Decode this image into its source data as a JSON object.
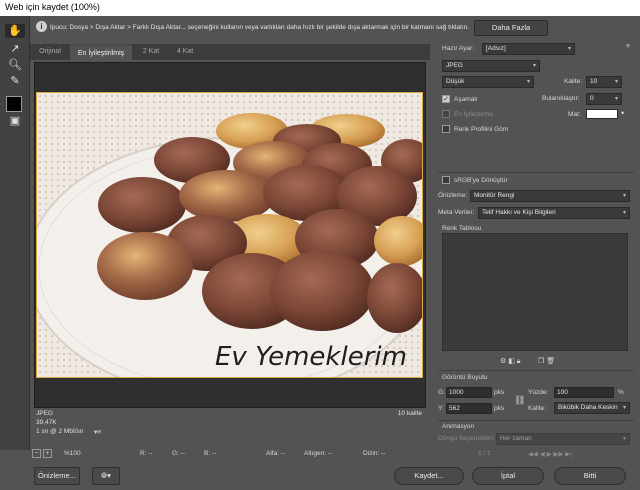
{
  "window": {
    "title": "Web için kaydet (100%)"
  },
  "tip": {
    "icon": "info-icon",
    "text": "İpucu: Dosya > Dışa Aktar > Farklı Dışa Aktar... seçeneğini kullanın veya varlıkları daha hızlı bir şekilde dışa aktarmak için bir katmanı sağ tıklatın.",
    "button": "Daha Fazla"
  },
  "tools": [
    "hand-icon",
    "slice-select-icon",
    "zoom-icon",
    "eyedropper-icon",
    "eyedropper-color-swatch",
    "toggle-slices-icon"
  ],
  "tabs": [
    {
      "label": "Orijinal"
    },
    {
      "label": "En İyileştirilmiş"
    },
    {
      "label": "2 Kat"
    },
    {
      "label": "4 Kat"
    }
  ],
  "preview": {
    "watermark": "Ev Yemeklerim",
    "format": "JPEG",
    "size": "39,47K",
    "time": "1 sn @ 2 Mbİ/sn",
    "quality": "10 kalite"
  },
  "status": {
    "zoom": "%100",
    "r": "R: --",
    "g": "G: --",
    "b": "B: --",
    "alpha": "Alfa: --",
    "hex": "Altıgen: --",
    "index": "Dizin: --"
  },
  "bottom": {
    "preview": "Önizleme...",
    "save": "Kaydet...",
    "cancel": "İptal",
    "done": "Bitti"
  },
  "settings": {
    "preset_label": "Hazır Ayar:",
    "preset_value": "[Adsız]",
    "format": "JPEG",
    "quality_level": "Düşük",
    "quality_label": "Kalite:",
    "quality_value": "10",
    "progressive": "Aşamalı",
    "optimized": "En İyileştirme",
    "embed_profile": "Renk Profilini Göm",
    "blur_label": "Bulanıklaştır:",
    "blur_value": "0",
    "matte_label": "Mat:",
    "convert_srgb": "sRGB'ye Dönüştür",
    "preview_label": "Önizleme:",
    "preview_value": "Monitör Rengi",
    "metadata_label": "Meta Veriler:",
    "metadata_value": "Telif Hakkı ve Kişi Bilgileri"
  },
  "color_table": {
    "title": "Renk Tablosu"
  },
  "image_size": {
    "title": "Görüntü Boyutu",
    "w_label": "G:",
    "w_value": "1000",
    "w_unit": "pks",
    "h_label": "Y:",
    "h_value": "562",
    "h_unit": "pks",
    "percent_label": "Yüzde:",
    "percent_value": "100",
    "percent_unit": "%",
    "quality_label": "Kalite:",
    "quality_value": "Bikübik Daha Keskin"
  },
  "animation": {
    "title": "Animasyon",
    "loop_label": "Döngü Seçenekleri:",
    "loop_value": "Her zaman",
    "frame": "1 / 1"
  }
}
